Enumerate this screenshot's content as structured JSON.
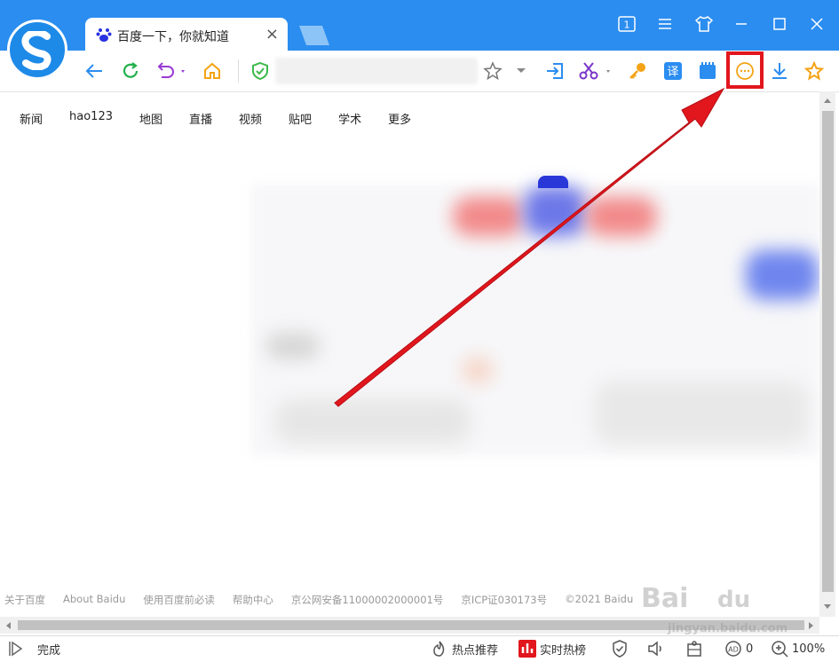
{
  "tab": {
    "title": "百度一下，你就知道",
    "close": "×"
  },
  "window": {
    "tab_count_badge": "1"
  },
  "nav_links": [
    "新闻",
    "hao123",
    "地图",
    "直播",
    "视频",
    "贴吧",
    "学术",
    "更多"
  ],
  "footer_links": [
    "关于百度",
    "About Baidu",
    "使用百度前必读",
    "帮助中心",
    "京公网安备11000002000001号",
    "京ICP证030173号",
    "©2021 Baidu"
  ],
  "status": {
    "ready": "完成",
    "hot_recommend": "热点推荐",
    "realtime_hot": "实时热榜",
    "ad_block_count": "0",
    "zoom": "100%"
  },
  "colors": {
    "titlebar": "#2b8df0",
    "highlight": "#e2161d",
    "arrow": "#e2161d"
  },
  "icons": [
    "back-icon",
    "refresh-icon",
    "undo-icon",
    "home-icon",
    "shield-icon",
    "star-icon",
    "login-icon",
    "scissors-icon",
    "key-icon",
    "translate-icon",
    "screenshot-icon",
    "more-icon",
    "download-icon",
    "favorite-icon"
  ]
}
